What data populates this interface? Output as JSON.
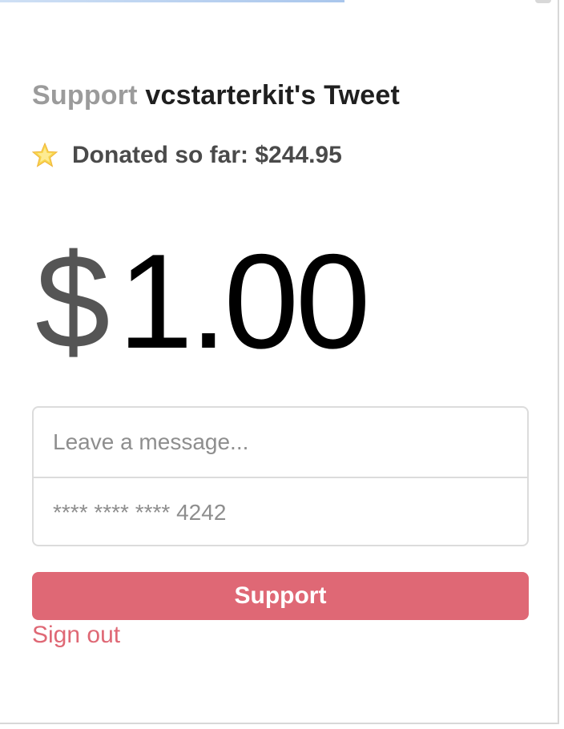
{
  "header": {
    "prefix": "Support",
    "target": "vcstarterkit's Tweet"
  },
  "donated": {
    "icon": "star-icon",
    "text": "Donated so far: $244.95"
  },
  "amount": {
    "currency": "$",
    "value": "1.00"
  },
  "form": {
    "message_placeholder": "Leave a message...",
    "card_placeholder": "**** **** **** 4242"
  },
  "actions": {
    "support_label": "Support",
    "signout_label": "Sign out"
  },
  "colors": {
    "accent": "#df6875",
    "muted_title": "#9b9b9b",
    "star": "#f5c542"
  }
}
